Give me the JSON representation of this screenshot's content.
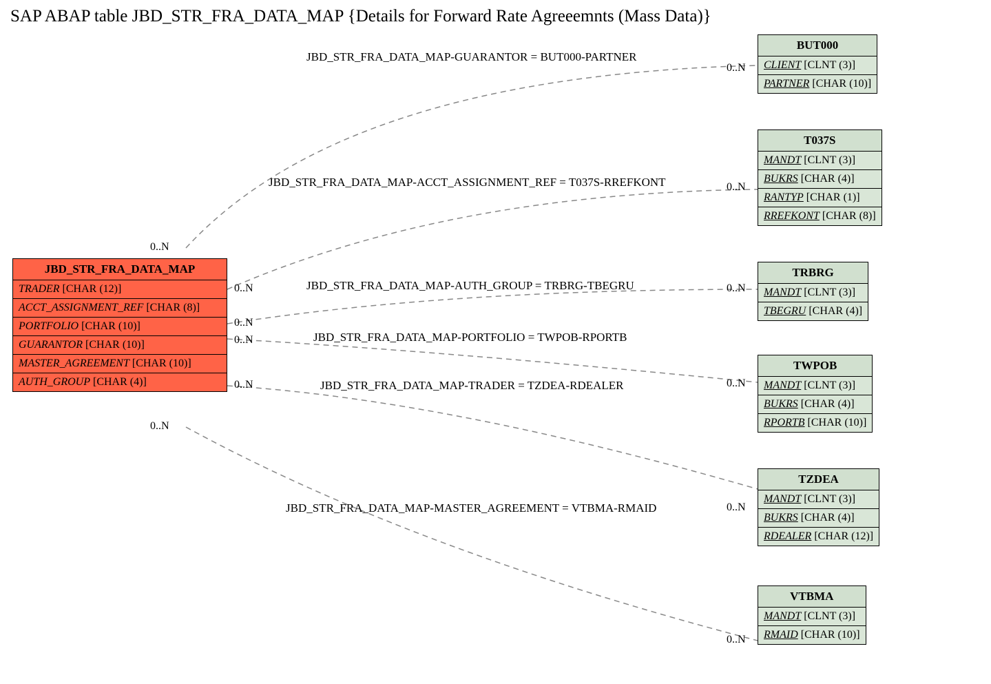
{
  "title": "SAP ABAP table JBD_STR_FRA_DATA_MAP {Details for Forward Rate Agreeemnts (Mass Data)}",
  "main_entity": {
    "name": "JBD_STR_FRA_DATA_MAP",
    "fields": [
      {
        "name": "TRADER",
        "type": "[CHAR (12)]",
        "underline": false
      },
      {
        "name": "ACCT_ASSIGNMENT_REF",
        "type": "[CHAR (8)]",
        "underline": false
      },
      {
        "name": "PORTFOLIO",
        "type": "[CHAR (10)]",
        "underline": false
      },
      {
        "name": "GUARANTOR",
        "type": "[CHAR (10)]",
        "underline": false
      },
      {
        "name": "MASTER_AGREEMENT",
        "type": "[CHAR (10)]",
        "underline": false
      },
      {
        "name": "AUTH_GROUP",
        "type": "[CHAR (4)]",
        "underline": false
      }
    ]
  },
  "ref_entities": [
    {
      "name": "BUT000",
      "fields": [
        {
          "name": "CLIENT",
          "type": "[CLNT (3)]",
          "underline": true
        },
        {
          "name": "PARTNER",
          "type": "[CHAR (10)]",
          "underline": true
        }
      ]
    },
    {
      "name": "T037S",
      "fields": [
        {
          "name": "MANDT",
          "type": "[CLNT (3)]",
          "underline": true
        },
        {
          "name": "BUKRS",
          "type": "[CHAR (4)]",
          "underline": true
        },
        {
          "name": "RANTYP",
          "type": "[CHAR (1)]",
          "underline": true
        },
        {
          "name": "RREFKONT",
          "type": "[CHAR (8)]",
          "underline": true
        }
      ]
    },
    {
      "name": "TRBRG",
      "fields": [
        {
          "name": "MANDT",
          "type": "[CLNT (3)]",
          "underline": true
        },
        {
          "name": "TBEGRU",
          "type": "[CHAR (4)]",
          "underline": true
        }
      ]
    },
    {
      "name": "TWPOB",
      "fields": [
        {
          "name": "MANDT",
          "type": "[CLNT (3)]",
          "underline": true
        },
        {
          "name": "BUKRS",
          "type": "[CHAR (4)]",
          "underline": true
        },
        {
          "name": "RPORTB",
          "type": "[CHAR (10)]",
          "underline": true
        }
      ]
    },
    {
      "name": "TZDEA",
      "fields": [
        {
          "name": "MANDT",
          "type": "[CLNT (3)]",
          "underline": true
        },
        {
          "name": "BUKRS",
          "type": "[CHAR (4)]",
          "underline": true
        },
        {
          "name": "RDEALER",
          "type": "[CHAR (12)]",
          "underline": true
        }
      ]
    },
    {
      "name": "VTBMA",
      "fields": [
        {
          "name": "MANDT",
          "type": "[CLNT (3)]",
          "underline": true
        },
        {
          "name": "RMAID",
          "type": "[CHAR (10)]",
          "underline": true
        }
      ]
    }
  ],
  "relations": [
    {
      "label": "JBD_STR_FRA_DATA_MAP-GUARANTOR = BUT000-PARTNER"
    },
    {
      "label": "JBD_STR_FRA_DATA_MAP-ACCT_ASSIGNMENT_REF = T037S-RREFKONT"
    },
    {
      "label": "JBD_STR_FRA_DATA_MAP-AUTH_GROUP = TRBRG-TBEGRU"
    },
    {
      "label": "JBD_STR_FRA_DATA_MAP-PORTFOLIO = TWPOB-RPORTB"
    },
    {
      "label": "JBD_STR_FRA_DATA_MAP-TRADER = TZDEA-RDEALER"
    },
    {
      "label": "JBD_STR_FRA_DATA_MAP-MASTER_AGREEMENT = VTBMA-RMAID"
    }
  ],
  "cardinality": "0..N"
}
